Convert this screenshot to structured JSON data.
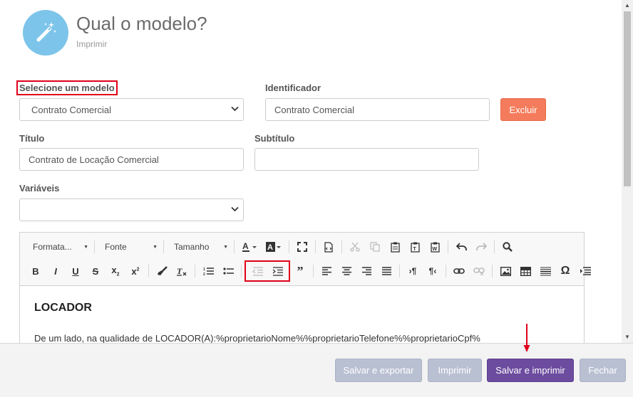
{
  "header": {
    "title": "Qual o modelo?",
    "subtitle": "Imprimir",
    "icon": "magic-wand-icon",
    "icon_bg": "#7cc4ea"
  },
  "form": {
    "model_label": "Selecione um modelo",
    "model_value": "Contrato Comercial",
    "identifier_label": "Identificador",
    "identifier_value": "Contrato Comercial",
    "delete_label": "Excluir",
    "title_label": "Título",
    "title_value": "Contrato de Locação Comercial",
    "subtitle_label": "Subtítulo",
    "subtitle_value": "",
    "variables_label": "Variáveis",
    "variables_value": ""
  },
  "editor": {
    "format_combo": "Formata...",
    "font_combo": "Fonte",
    "size_combo": "Tamanho",
    "heading": "LOCADOR",
    "body_text": "De um lado, na qualidade de LOCADOR(A):%proprietarioNome%%proprietarioTelefone%%proprietarioCpf%"
  },
  "footer": {
    "save_export": "Salvar e exportar",
    "print": "Imprimir",
    "save_print": "Salvar e imprimir",
    "close": "Fechar"
  },
  "colors": {
    "accent": "#6c4c9f",
    "danger": "#f47c5c",
    "highlight": "#e0001a",
    "disabled": "#b9c0d2"
  }
}
